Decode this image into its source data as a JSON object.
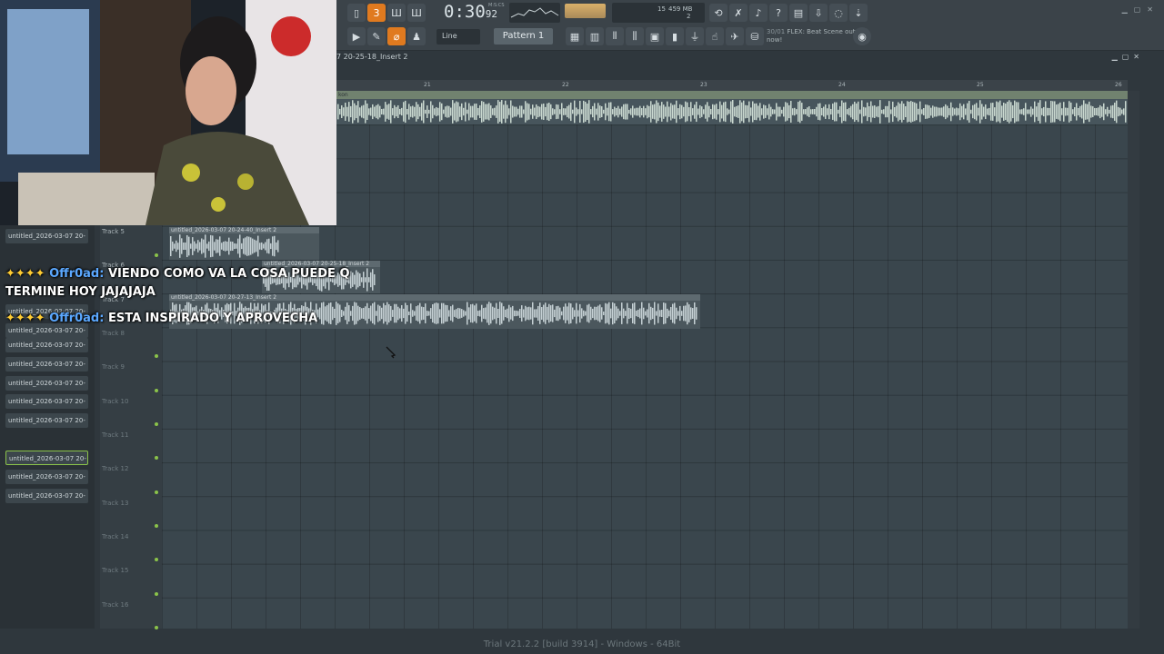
{
  "toolbar": {
    "time": "0:30",
    "time_frac": "92",
    "time_unit": "M:S:CS",
    "cpu_val1": "15",
    "cpu_mem": "459 MB",
    "cpu_val2": "2",
    "snap": "Line",
    "pattern": "Pattern 1",
    "news_num": "30/01",
    "news_text": "FLEX: Beat Scene out now!"
  },
  "playlist": {
    "title": "7 20-25-18_Insert 2",
    "ruler": [
      "21",
      "22",
      "23",
      "24",
      "25",
      "26"
    ],
    "top_clip_label": "kon"
  },
  "tracks": [
    "Track 5",
    "Track 6",
    "Track 7",
    "Track 8",
    "Track 9",
    "Track 10",
    "Track 11",
    "Track 12",
    "Track 13",
    "Track 14",
    "Track 15",
    "Track 16"
  ],
  "clips": [
    {
      "label": "untitled_2026-03-07 20-24-40_Insert 2"
    },
    {
      "label": "untitled_2026-03-07 20-25-18_Insert 2"
    },
    {
      "label": "untitled_2026-03-07 20-27-13_Insert 2"
    }
  ],
  "browser": {
    "items": [
      "untitled_2026-03-07 20-",
      "untitled_2026-03-07 20-",
      "untitled_2026-03-07 20-",
      "untitled_2026-03-07 20-",
      "untitled_2026-03-07 20-",
      "untitled_2026-03-07 20-",
      "untitled_2026-03-07 20-",
      "untitled_2026-03-07 20-",
      "untitled_2026-03-07 20-",
      "untitled_2026-03-07 20-",
      "untitled_2026-03-07 20-"
    ],
    "selected_index": 7
  },
  "chat": [
    {
      "user": "Offr0ad:",
      "text": "VIENDO COMO VA LA COSA PUEDE Q"
    },
    {
      "user": "",
      "text": "TERMINE HOY JAJAJAJA"
    },
    {
      "user": "Offr0ad:",
      "text": "ESTA INSPIRADO Y APROVECHA"
    }
  ],
  "status": "Trial v21.2.2 [build 3914] - Windows - 64Bit",
  "colors": {
    "accent": "#e07a1f",
    "track_dot": "#8bc34a",
    "chat_user": "#5ba8ff"
  }
}
